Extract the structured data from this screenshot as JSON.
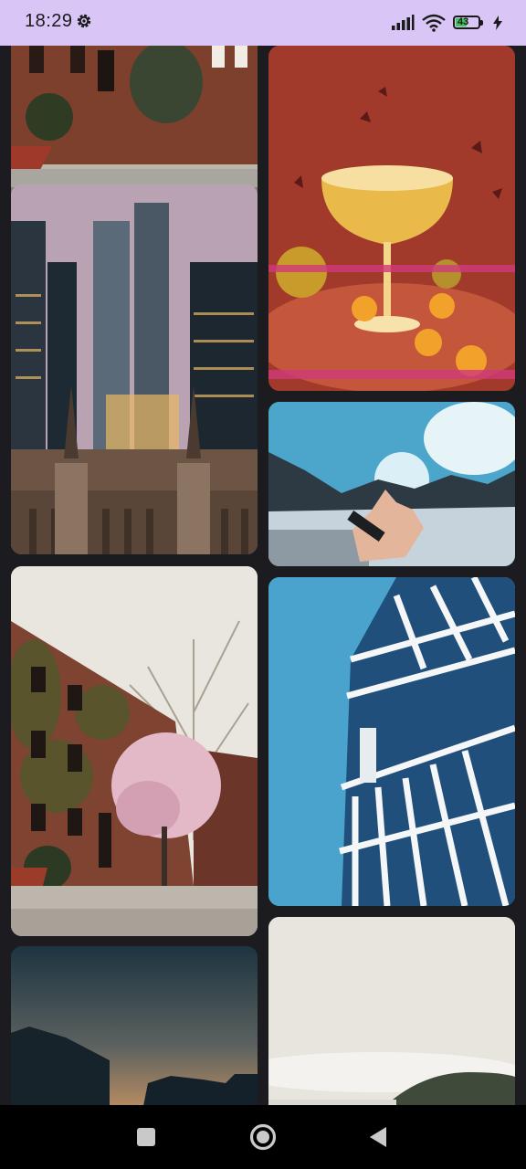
{
  "status_bar": {
    "time": "18:29",
    "battery_percent": "43",
    "icons": [
      "settings-gear-icon",
      "signal-icon",
      "wifi-icon",
      "battery-icon",
      "charging-bolt-icon"
    ]
  },
  "feed": {
    "tiles": [
      {
        "name": "brick-townhouse-street-photo"
      },
      {
        "name": "city-skyscrapers-photo"
      },
      {
        "name": "golden-cocktail-photo"
      },
      {
        "name": "hand-reaching-sun-mountains-photo"
      },
      {
        "name": "modern-building-facade-photo"
      },
      {
        "name": "ivy-brick-building-blossom-tree-photo"
      },
      {
        "name": "dusk-silhouette-houses-photo"
      },
      {
        "name": "hazy-landscape-photo"
      }
    ]
  },
  "nav_bar": {
    "buttons": [
      "recents-square-icon",
      "home-circle-icon",
      "back-triangle-icon"
    ]
  },
  "colors": {
    "status_bar_bg": "#d9c5f6",
    "page_bg": "#1c1b20",
    "nav_bg": "#000000",
    "battery_fill": "#3cc45a"
  }
}
